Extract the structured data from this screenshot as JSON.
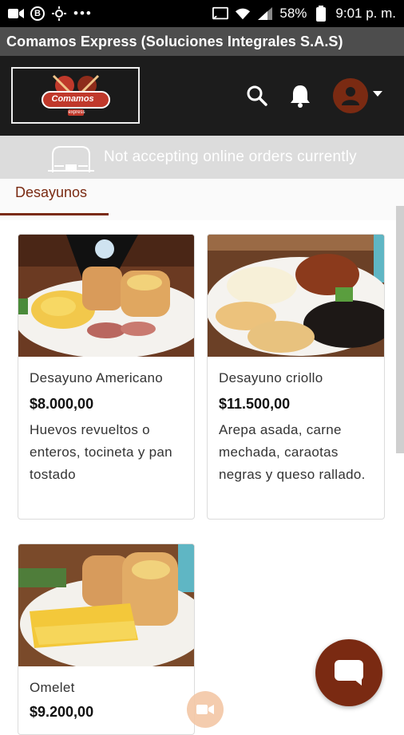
{
  "status_bar": {
    "battery": "58%",
    "time": "9:01 p. m.",
    "dots": "•••"
  },
  "window": {
    "title": "Comamos Express (Soluciones Integrales S.A.S)"
  },
  "header": {
    "logo_text": "Comamos",
    "logo_subtext": "express",
    "icons": [
      "search-icon",
      "bell-icon",
      "user-icon",
      "caret-down-icon"
    ]
  },
  "notice": {
    "text": "Not accepting online orders currently"
  },
  "tabs": [
    {
      "label": "Desayunos",
      "active": true
    }
  ],
  "products": [
    {
      "name": "Desayuno Americano",
      "price": "$8.000,00",
      "description": "Huevos revueltos o enteros, tocineta y pan tostado"
    },
    {
      "name": "Desayuno criollo",
      "price": "$11.500,00",
      "description": "Arepa asada, carne mechada, caraotas negras y queso rallado."
    },
    {
      "name": "Omelet",
      "price": "$9.200,00",
      "description": ""
    }
  ],
  "colors": {
    "accent": "#7a2a12",
    "header_bg": "#1c1c1c",
    "title_bar_bg": "#4d4d4d",
    "notice_bg": "#dcdcdc"
  }
}
